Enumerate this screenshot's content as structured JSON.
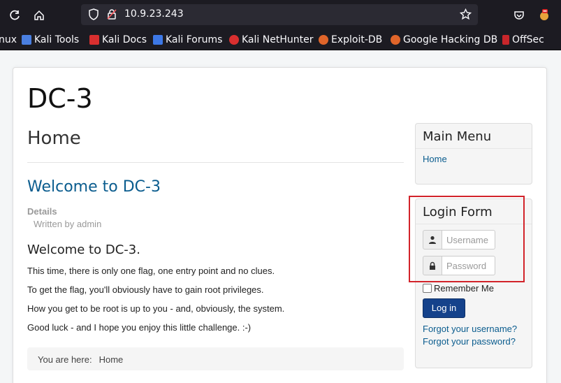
{
  "browser": {
    "url": "10.9.23.243",
    "bookmarks": [
      "nux",
      "Kali Tools",
      "Kali Docs",
      "Kali Forums",
      "Kali NetHunter",
      "Exploit-DB",
      "Google Hacking DB",
      "OffSec"
    ]
  },
  "page": {
    "site_title": "DC-3",
    "page_heading": "Home",
    "article_title": "Welcome to DC-3",
    "details_label": "Details",
    "author": "Written by admin",
    "subheading": "Welcome to DC-3.",
    "paragraphs": [
      "This time, there is only one flag, one entry point and no clues.",
      "To get the flag, you'll obviously have to gain root privileges.",
      "How you get to be root is up to you - and, obviously, the system.",
      "Good luck - and I hope you enjoy this little challenge.  :-)"
    ],
    "breadcrumb": {
      "prefix": "You are here:",
      "current": "Home"
    }
  },
  "sidebar": {
    "main_menu": {
      "title": "Main Menu",
      "items": [
        "Home"
      ]
    },
    "login": {
      "title": "Login Form",
      "username_placeholder": "Username",
      "password_placeholder": "Password",
      "remember_label": "Remember Me",
      "button_label": "Log in",
      "forgot_username": "Forgot your username?",
      "forgot_password": "Forgot your password?"
    }
  },
  "colors": {
    "accent": "#0a5c8e",
    "button": "#15428b",
    "highlight": "#d2232a"
  }
}
